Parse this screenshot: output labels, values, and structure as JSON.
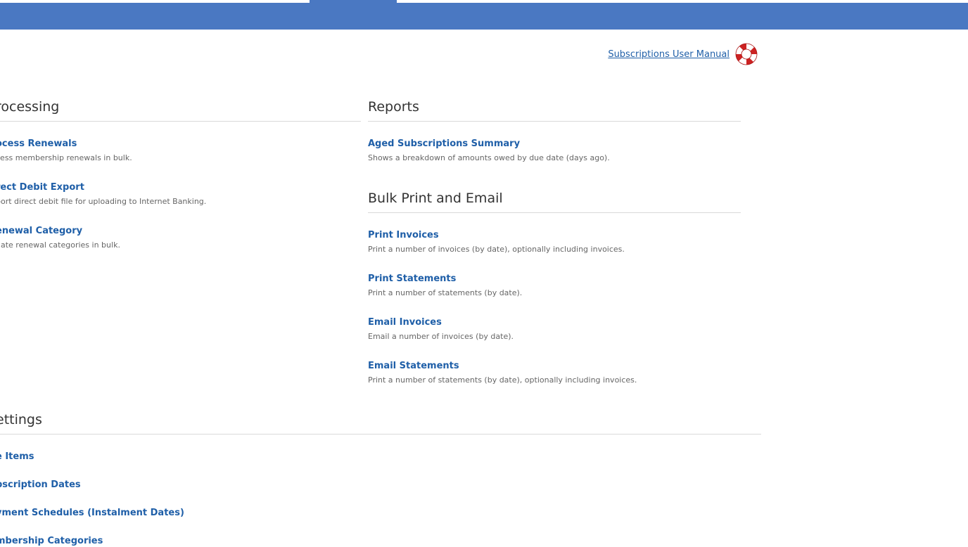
{
  "header": {
    "colors": {
      "bar": "#4a78c2",
      "link": "#1f5fa8"
    }
  },
  "help": {
    "manual_label": "Subscriptions User Manual",
    "icon": "lifebuoy-icon"
  },
  "processing": {
    "title": "rocessing",
    "items": [
      {
        "label": "ocess Renewals",
        "desc": "cess membership renewals in bulk."
      },
      {
        "label": "rect Debit Export",
        "desc": "port direct debit file for uploading to Internet Banking."
      },
      {
        "label": "enewal Category",
        "desc": "date renewal categories in bulk."
      }
    ]
  },
  "reports": {
    "title": "Reports",
    "items": [
      {
        "label": "Aged Subscriptions Summary",
        "desc": "Shows a breakdown of amounts owed by due date (days ago)."
      }
    ]
  },
  "bulk": {
    "title": "Bulk Print and Email",
    "items": [
      {
        "label": "Print Invoices",
        "desc": "Print a number of invoices (by date), optionally including invoices."
      },
      {
        "label": "Print Statements",
        "desc": "Print a number of statements (by date)."
      },
      {
        "label": "Email Invoices",
        "desc": "Email a number of invoices (by date)."
      },
      {
        "label": "Email Statements",
        "desc": "Print a number of statements (by date), optionally including invoices."
      }
    ]
  },
  "settings": {
    "title": "ettings",
    "items": [
      {
        "label": "e Items"
      },
      {
        "label": "bscription Dates"
      },
      {
        "label": "yment Schedules (Instalment Dates)"
      },
      {
        "label": "mbership Categories"
      }
    ]
  }
}
